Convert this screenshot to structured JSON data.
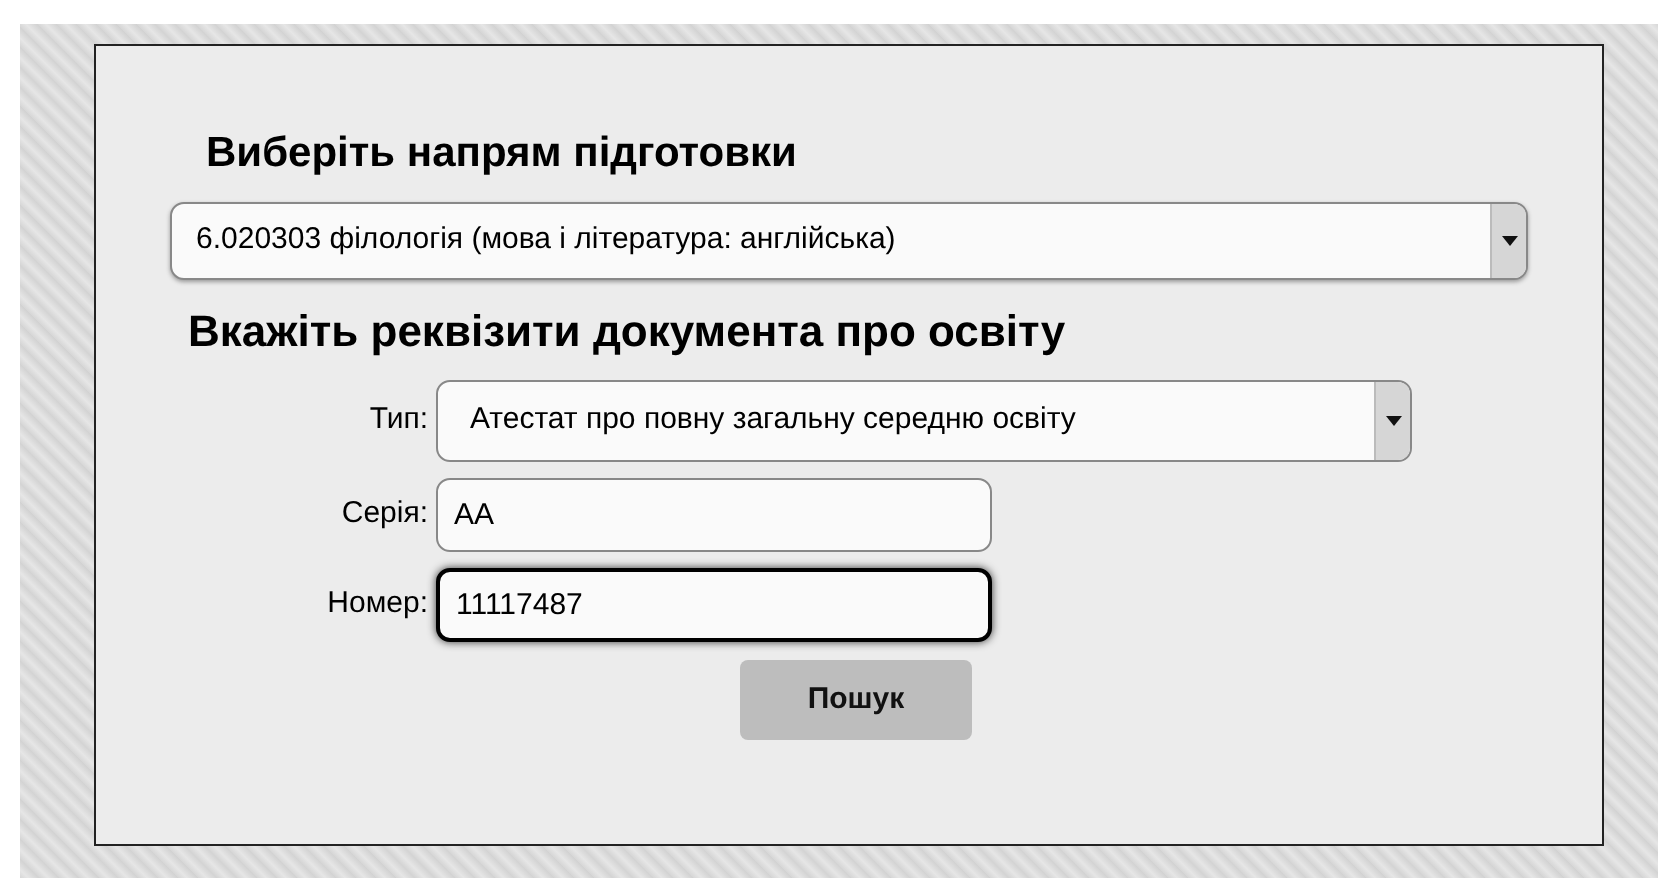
{
  "direction": {
    "heading": "Виберіть напрям підготовки",
    "select_value": "6.020303 філологія (мова і література: англійська)"
  },
  "document": {
    "heading": "Вкажіть реквізити документа про освіту",
    "fields": [
      {
        "kind": "select",
        "label": "Тип:",
        "value": "Атестат про повну загальну середню освіту",
        "focused": false
      },
      {
        "kind": "text",
        "label": "Серія:",
        "value": "АА",
        "focused": false
      },
      {
        "kind": "text",
        "label": "Номер:",
        "value": "11117487",
        "focused": true
      }
    ],
    "button": "Пошук"
  }
}
